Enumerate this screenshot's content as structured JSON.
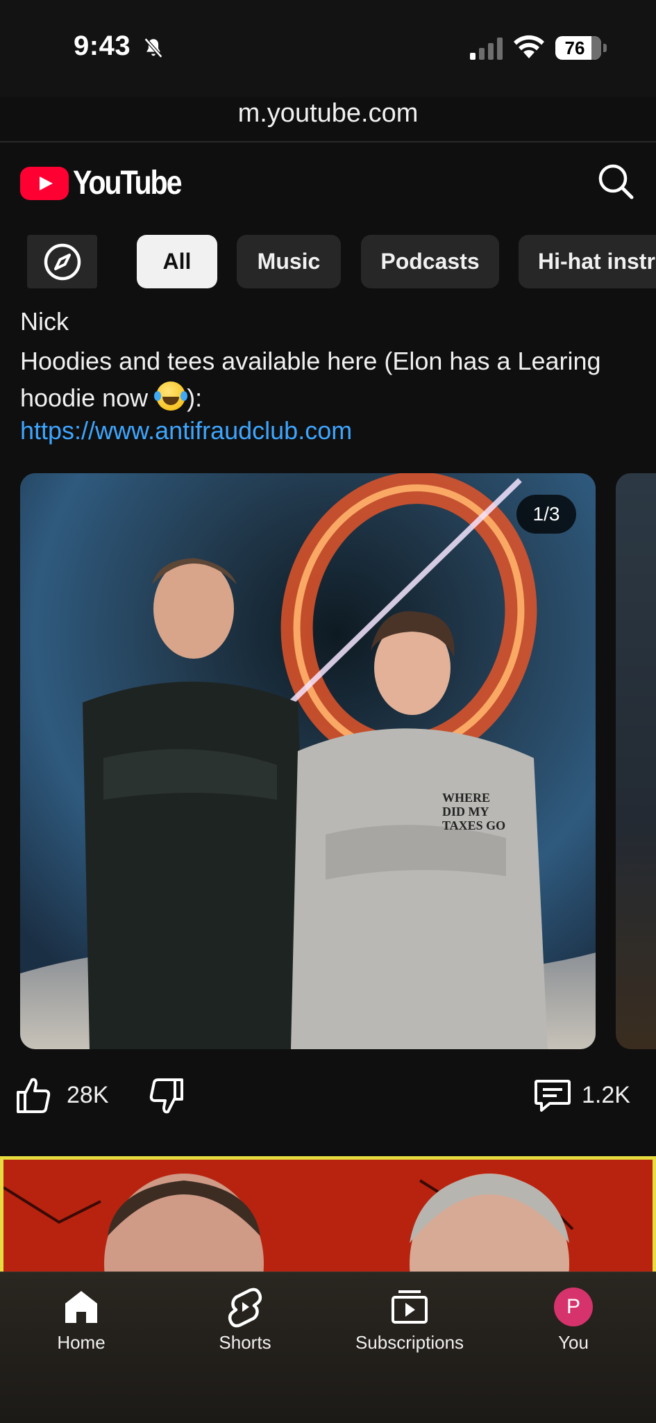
{
  "status_bar": {
    "time": "9:43",
    "battery": "76",
    "url": "m.youtube.com"
  },
  "header": {
    "logo_text": "YouTube",
    "brand_color": "#ff0033"
  },
  "chips": {
    "explore_icon": "compass-icon",
    "items": [
      {
        "label": "All",
        "active": true
      },
      {
        "label": "Music",
        "active": false
      },
      {
        "label": "Podcasts",
        "active": false
      },
      {
        "label": "Hi-hat instr",
        "active": false
      }
    ]
  },
  "post": {
    "author": "Nick",
    "text_before_emoji": "Hoodies and tees available here (Elon has a Learing hoodie now ",
    "emoji": "face-with-tears-of-joy",
    "text_after_emoji": "):",
    "link": "https://www.antifraudclub.com",
    "image_counter": "1/3",
    "hoodie_print": "WHERE DID MY TAXES GO",
    "likes": "28K",
    "comments": "1.2K",
    "link_color": "#3ea6ff"
  },
  "bottom_nav": {
    "items": [
      {
        "label": "Home",
        "icon": "home-icon"
      },
      {
        "label": "Shorts",
        "icon": "shorts-icon"
      },
      {
        "label": "Subscriptions",
        "icon": "subscriptions-icon"
      },
      {
        "label": "You",
        "icon": "avatar",
        "avatar_letter": "P",
        "avatar_color": "#d6336c"
      }
    ]
  }
}
